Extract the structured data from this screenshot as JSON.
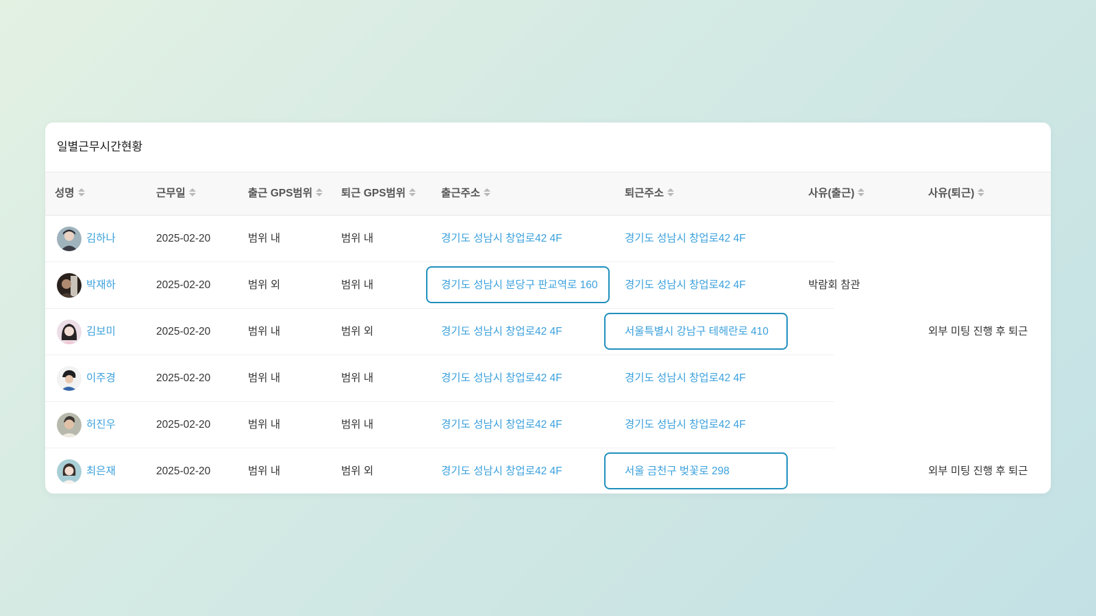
{
  "card": {
    "title": "일별근무시간현황"
  },
  "columns": [
    {
      "key": "name",
      "label": "성명"
    },
    {
      "key": "date",
      "label": "근무일"
    },
    {
      "key": "in_gps",
      "label": "출근 GPS범위"
    },
    {
      "key": "out_gps",
      "label": "퇴근 GPS범위"
    },
    {
      "key": "in_addr",
      "label": "출근주소"
    },
    {
      "key": "out_addr",
      "label": "퇴근주소"
    },
    {
      "key": "reason_in",
      "label": "사유(출근)"
    },
    {
      "key": "reason_out",
      "label": "사유(퇴근)"
    }
  ],
  "rows": [
    {
      "name": "김하나",
      "date": "2025-02-20",
      "in_gps": "범위 내",
      "out_gps": "범위 내",
      "in_addr": "경기도 성남시 창업로42  4F",
      "out_addr": "경기도 성남시 창업로42  4F",
      "reason_in": "",
      "reason_out": ""
    },
    {
      "name": "박재하",
      "date": "2025-02-20",
      "in_gps": "범위 외",
      "out_gps": "범위 내",
      "in_addr": "경기도 성남시 분당구 판교역로 160",
      "out_addr": "경기도 성남시 창업로42  4F",
      "reason_in": "박람회 참관",
      "reason_out": ""
    },
    {
      "name": "김보미",
      "date": "2025-02-20",
      "in_gps": "범위 내",
      "out_gps": "범위 외",
      "in_addr": "경기도 성남시 창업로42  4F",
      "out_addr": "서울특별시 강남구 테헤란로 410",
      "reason_in": "",
      "reason_out": "외부 미팅 진행 후 퇴근"
    },
    {
      "name": "이주경",
      "date": "2025-02-20",
      "in_gps": "범위 내",
      "out_gps": "범위 내",
      "in_addr": "경기도 성남시 창업로42  4F",
      "out_addr": "경기도 성남시 창업로42  4F",
      "reason_in": "",
      "reason_out": ""
    },
    {
      "name": "허진우",
      "date": "2025-02-20",
      "in_gps": "범위 내",
      "out_gps": "범위 내",
      "in_addr": "경기도 성남시 창업로42  4F",
      "out_addr": "경기도 성남시 창업로42  4F",
      "reason_in": "",
      "reason_out": ""
    },
    {
      "name": "최은재",
      "date": "2025-02-20",
      "in_gps": "범위 내",
      "out_gps": "범위 외",
      "in_addr": "경기도 성남시 창업로42  4F",
      "out_addr": "서울 금천구 벚꽃로 298",
      "reason_in": "",
      "reason_out": "외부 미팅 진행 후 퇴근"
    }
  ],
  "colors": {
    "link": "#3aa0dc",
    "highlight_border": "#1f8fbd",
    "sort_icon": "#b9b9b9"
  }
}
